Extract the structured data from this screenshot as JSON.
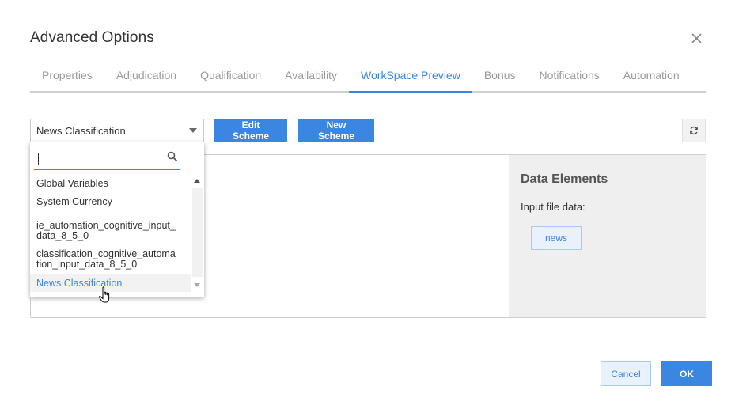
{
  "dialog": {
    "title": "Advanced Options",
    "close_icon": "close-icon"
  },
  "tabs": [
    {
      "label": "Properties",
      "active": false
    },
    {
      "label": "Adjudication",
      "active": false
    },
    {
      "label": "Qualification",
      "active": false
    },
    {
      "label": "Availability",
      "active": false
    },
    {
      "label": "WorkSpace Preview",
      "active": true
    },
    {
      "label": "Bonus",
      "active": false
    },
    {
      "label": "Notifications",
      "active": false
    },
    {
      "label": "Automation",
      "active": false
    }
  ],
  "toolbar": {
    "scheme_selected": "News Classification",
    "edit_label": "Edit Scheme",
    "new_label": "New Scheme",
    "refresh_icon": "refresh-icon"
  },
  "dropdown": {
    "search_value": "",
    "search_icon": "search-icon",
    "options": [
      "Global Variables",
      "System Currency",
      "ie_automation_cognitive_input_\ndata_8_5_0",
      "classification_cognitive_automa\ntion_input_data_8_5_0",
      "News Classification"
    ],
    "selected": "News Classification"
  },
  "data_elements": {
    "title": "Data Elements",
    "subtitle": "Input file data:",
    "chips": [
      "news"
    ]
  },
  "footer": {
    "cancel_label": "Cancel",
    "ok_label": "OK"
  },
  "colors": {
    "accent": "#3b86e0",
    "tab_inactive": "#9a9a9a",
    "panel_bg": "#efefef"
  }
}
